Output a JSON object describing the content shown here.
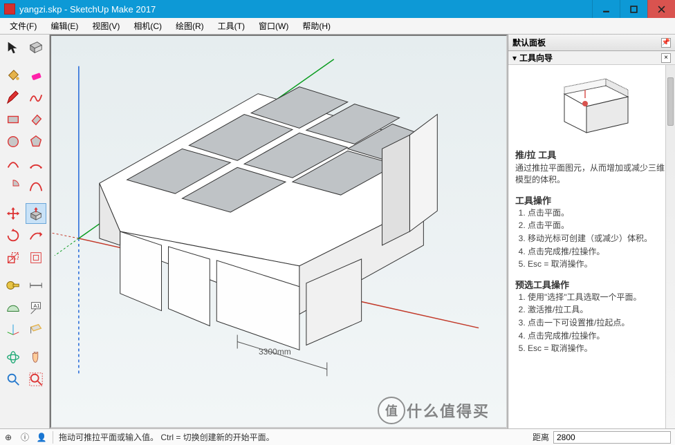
{
  "window": {
    "file": "yangzi.skp",
    "app": "SketchUp Make 2017"
  },
  "menu": [
    "文件(F)",
    "编辑(E)",
    "视图(V)",
    "相机(C)",
    "绘图(R)",
    "工具(T)",
    "窗口(W)",
    "帮助(H)"
  ],
  "tools": {
    "groups": [
      [
        "select",
        "eraser-block"
      ],
      [
        "paint-bucket",
        "eraser"
      ],
      [
        "pencil",
        "freehand"
      ],
      [
        "rectangle",
        "rotated-rect"
      ],
      [
        "circle",
        "polygon"
      ],
      [
        "arc",
        "arc2"
      ],
      [
        "pie-arc",
        "bezier"
      ],
      [
        "move",
        "push-pull"
      ],
      [
        "rotate",
        "follow-me"
      ],
      [
        "scale",
        "offset"
      ],
      [
        "tape",
        "dimension"
      ],
      [
        "protractor",
        "text"
      ],
      [
        "axes",
        "section"
      ],
      [
        "orbit",
        "pan"
      ],
      [
        "zoom",
        "zoom-extents"
      ]
    ],
    "selected": "push-pull"
  },
  "viewport": {
    "dimension_label": "3300mm"
  },
  "panel": {
    "title": "默认面板",
    "section": "工具向导",
    "help": {
      "tool_title": "推/拉 工具",
      "tool_desc": "通过推拉平面图元，从而增加或减少三维模型的体积。",
      "op_title": "工具操作",
      "ops": [
        "点击平面。",
        "点击平面。",
        "移动光标可创建（或减少）体积。",
        "点击完成推/拉操作。",
        "Esc = 取消操作。"
      ],
      "pre_title": "预选工具操作",
      "pres": [
        "使用\"选择\"工具选取一个平面。",
        "激活推/拉工具。",
        "点击一下可设置推/拉起点。",
        "点击完成推/拉操作。",
        "Esc = 取消操作。"
      ]
    }
  },
  "status": {
    "hint": "拖动可推拉平面或输入值。 Ctrl = 切换创建新的开始平面。",
    "dist_label": "距离",
    "dist_value": "2800"
  },
  "watermark": {
    "char": "值",
    "text": "什么值得买"
  }
}
